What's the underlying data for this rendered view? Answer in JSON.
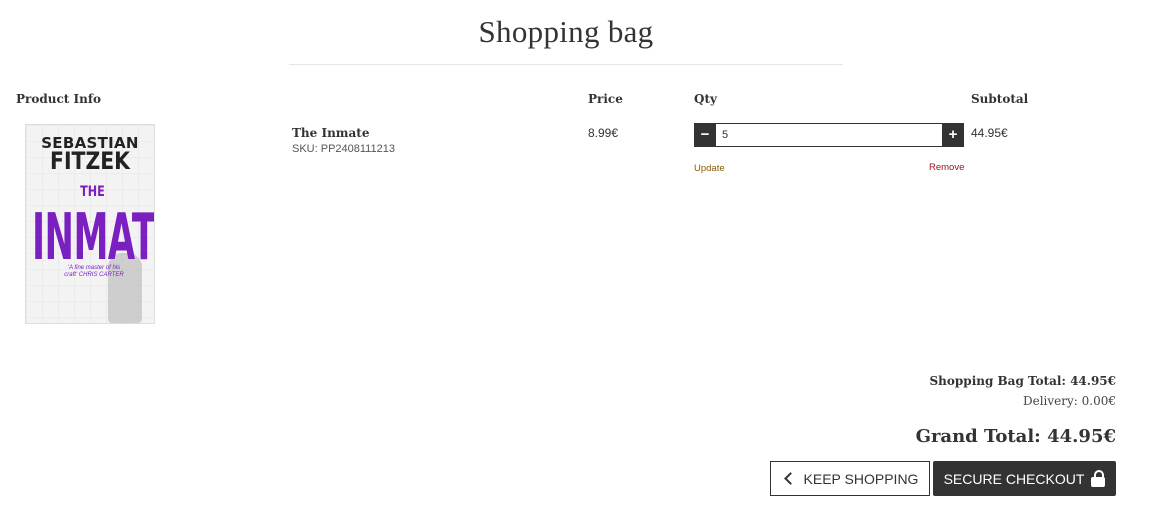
{
  "page": {
    "title": "Shopping bag"
  },
  "table": {
    "headers": {
      "product": "Product Info",
      "price": "Price",
      "qty": "Qty",
      "subtotal": "Subtotal"
    }
  },
  "item": {
    "name": "The Inmate",
    "sku": "SKU: PP2408111213",
    "price": "8.99€",
    "qty": "5",
    "subtotal": "44.95€",
    "update_label": "Update",
    "remove_label": "Remove",
    "cover": {
      "author_first": "SEBASTIAN",
      "author_last": "FITZEK",
      "title_small": "THE",
      "title_big": "INMATE",
      "blurb": "'A fine master of his craft' CHRIS CARTER"
    },
    "qty_minus": "−",
    "qty_plus": "+"
  },
  "totals": {
    "bag_total": "Shopping Bag Total: 44.95€",
    "delivery": "Delivery: 0.00€",
    "grand_total": "Grand Total: 44.95€"
  },
  "actions": {
    "keep_shopping": "KEEP SHOPPING",
    "secure_checkout": "SECURE CHECKOUT"
  },
  "icons": {
    "keep_shopping": "chevron-left-icon",
    "checkout": "lock-icon"
  },
  "colors": {
    "dark": "#333333",
    "update_link": "#8a5a00",
    "remove_link": "#a0141e",
    "cover_purple": "#7a1fc0"
  }
}
